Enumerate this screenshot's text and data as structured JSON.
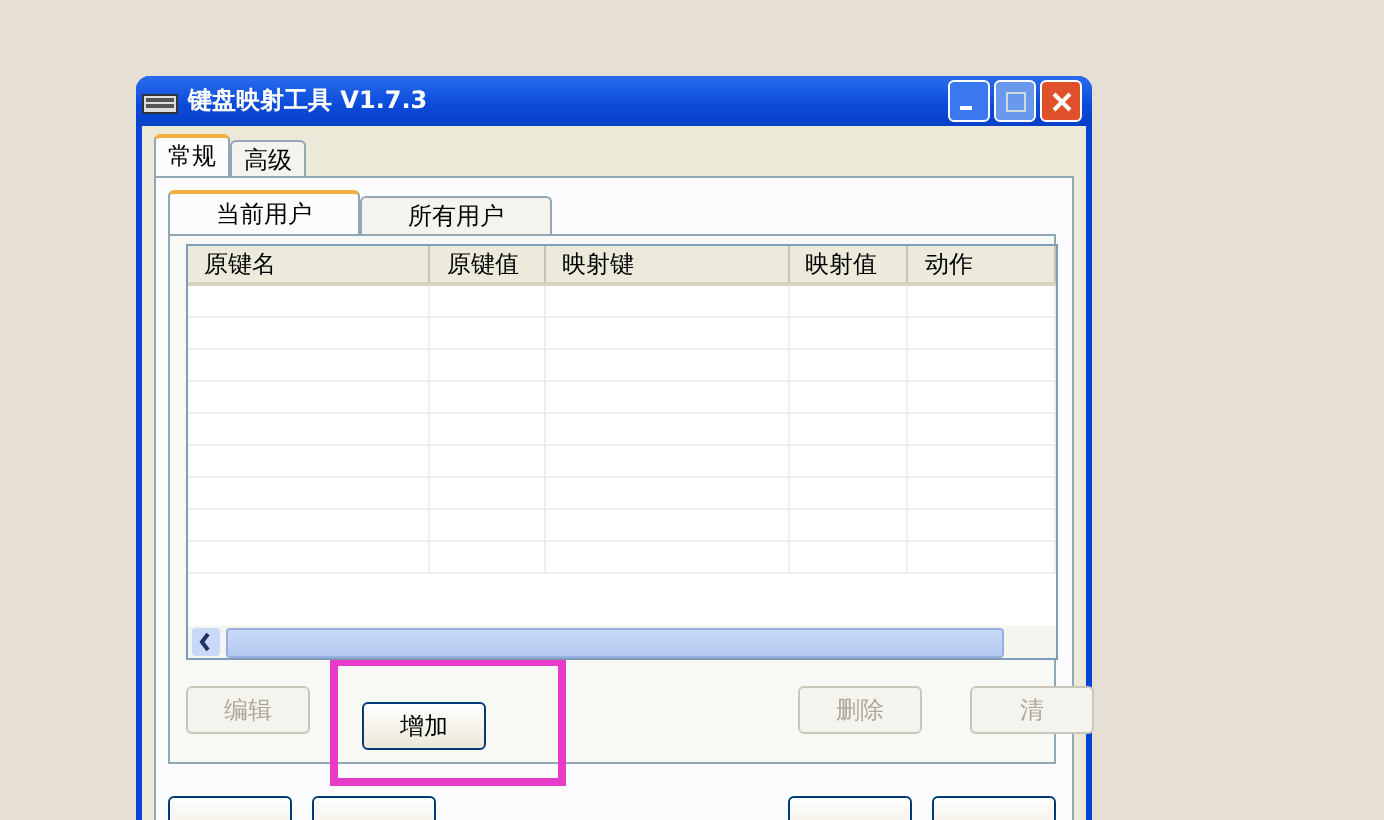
{
  "window": {
    "title": "键盘映射工具 V1.7.3"
  },
  "tabs": [
    {
      "label": "常规",
      "selected": true
    },
    {
      "label": "高级",
      "selected": false
    }
  ],
  "user_tabs": [
    {
      "label": "当前用户",
      "selected": true
    },
    {
      "label": "所有用户",
      "selected": false
    }
  ],
  "table": {
    "columns": [
      "原键名",
      "原键值",
      "映射键",
      "映射值",
      "动作"
    ]
  },
  "list_buttons": [
    {
      "label": "编辑",
      "disabled": true,
      "highlighted": false
    },
    {
      "label": "增加",
      "disabled": false,
      "highlighted": true
    },
    {
      "label": "删除",
      "disabled": true,
      "highlighted": false
    },
    {
      "label": "清",
      "disabled": true,
      "highlighted": false
    }
  ]
}
